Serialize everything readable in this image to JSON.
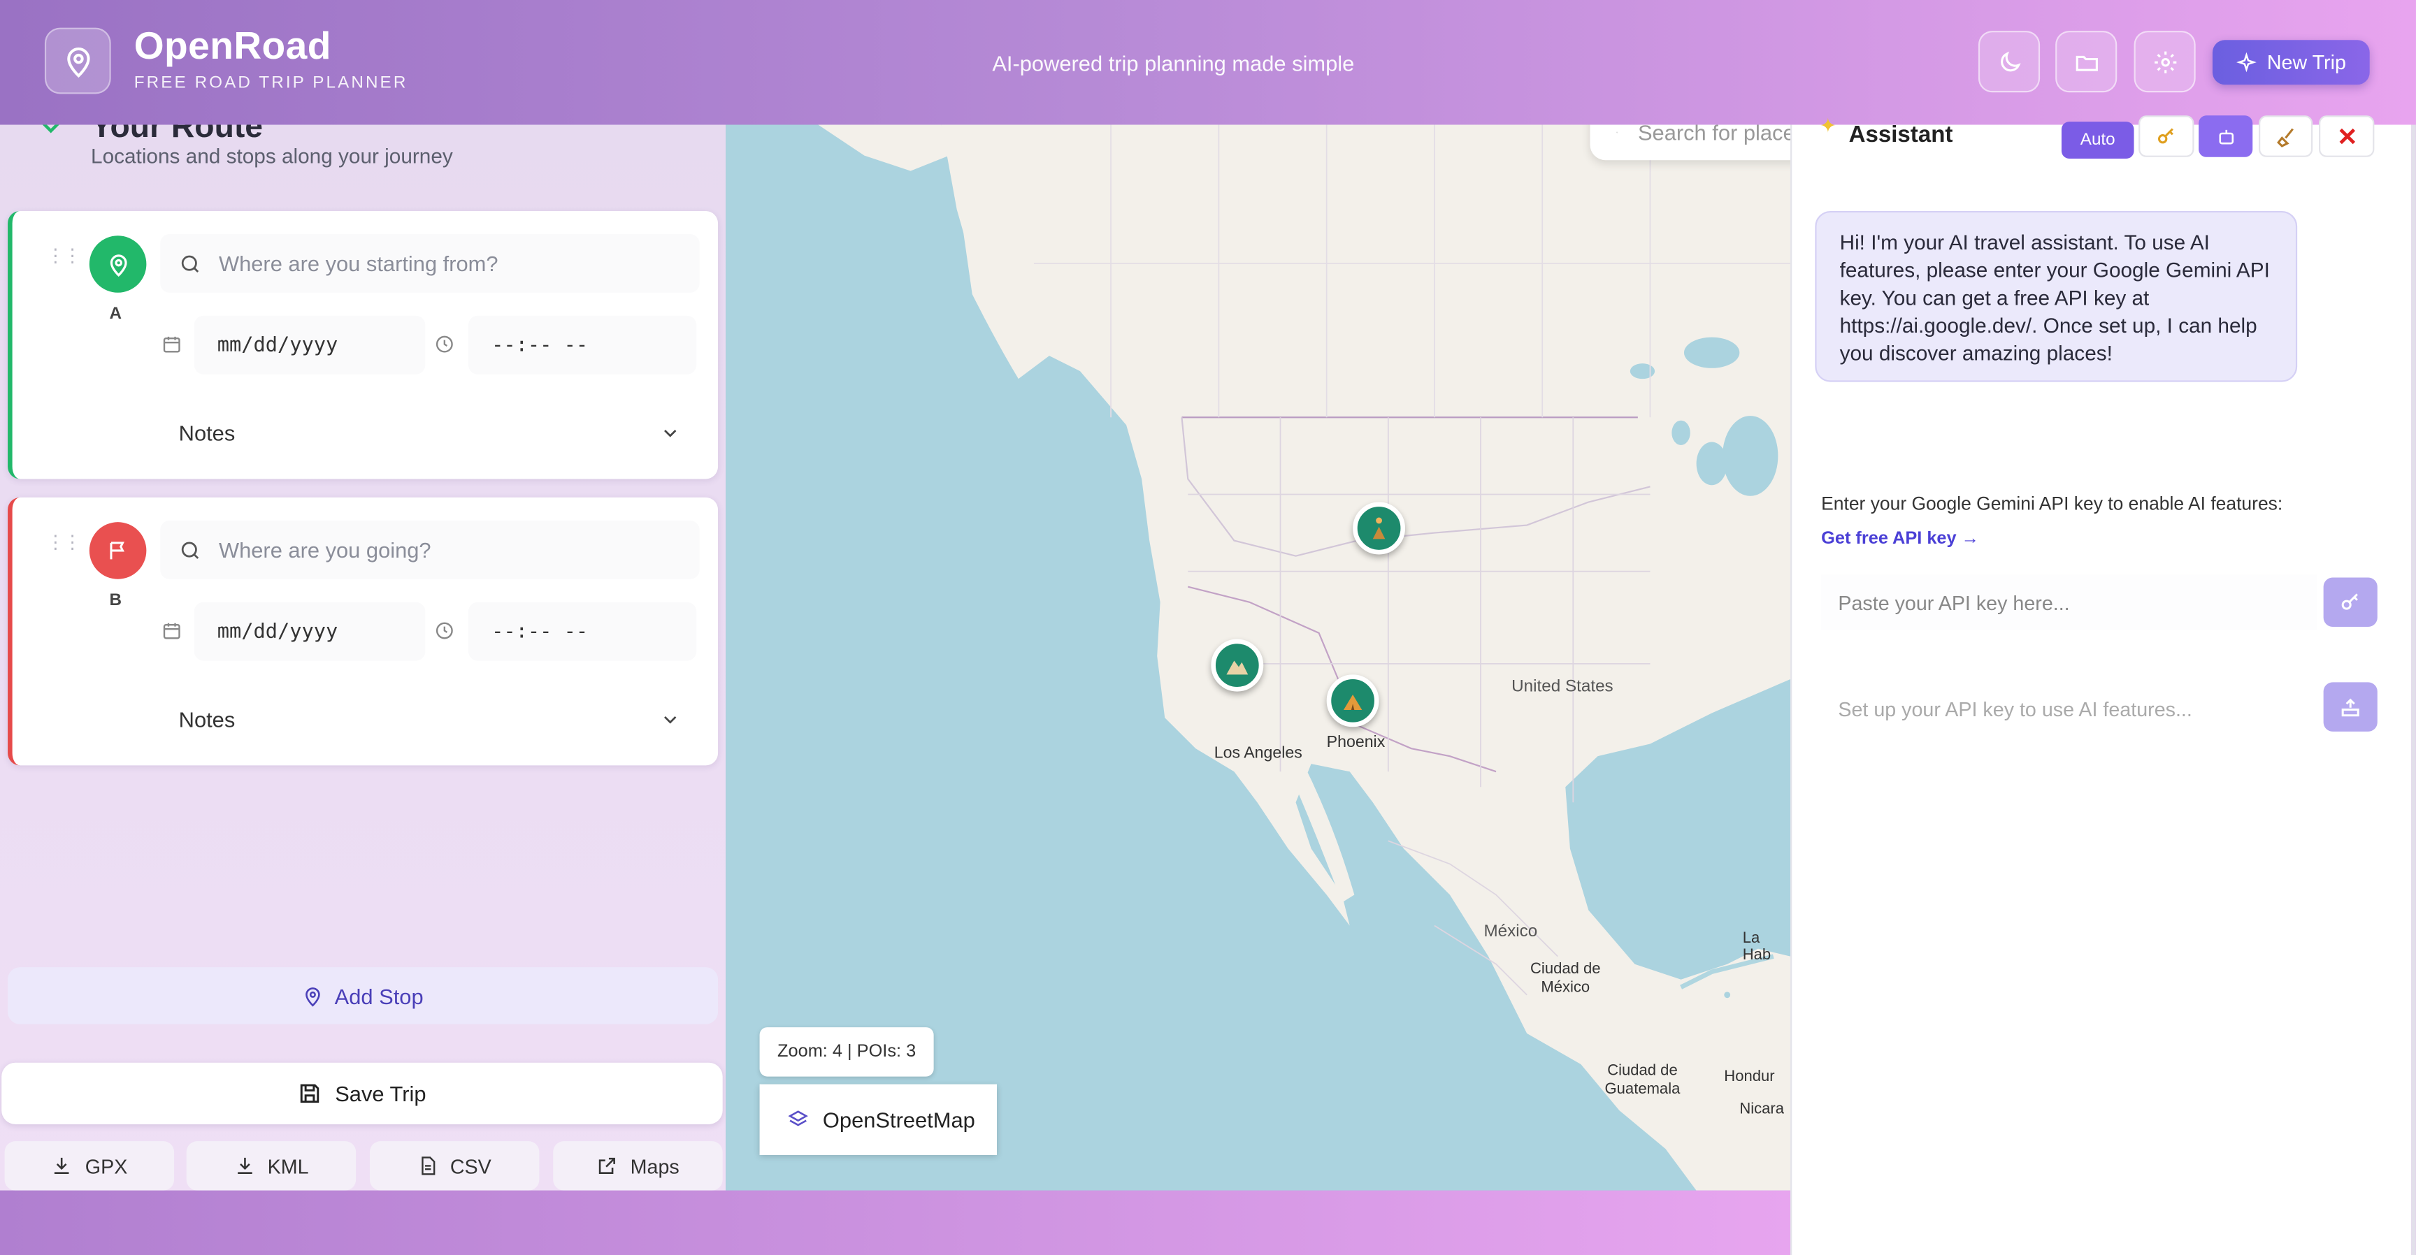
{
  "header": {
    "app_name": "OpenRoad",
    "tagline": "FREE ROAD TRIP PLANNER",
    "center_tagline": "AI-powered trip planning made simple",
    "new_trip_label": "New Trip"
  },
  "route": {
    "title": "Your Route",
    "subtitle": "Locations and stops along your journey",
    "stops": [
      {
        "letter": "A",
        "placeholder": "Where are you starting from?",
        "date": "mm/dd/yyyy",
        "time": "--:-- --",
        "notes_label": "Notes",
        "color": "#22b86a"
      },
      {
        "letter": "B",
        "placeholder": "Where are you going?",
        "date": "mm/dd/yyyy",
        "time": "--:-- --",
        "notes_label": "Notes",
        "color": "#e95050"
      }
    ],
    "add_stop_label": "Add Stop",
    "save_trip_label": "Save Trip",
    "exports": [
      "GPX",
      "KML",
      "CSV",
      "Maps"
    ]
  },
  "map": {
    "search_placeholder": "Search for places",
    "labels": {
      "united_states": "United States",
      "los_angeles": "Los Angeles",
      "phoenix": "Phoenix",
      "mexico": "México",
      "mexico_city": "Ciudad de México",
      "guatemala": "Ciudad de Guatemala",
      "honduras": "Hondur",
      "nicaragua": "Nicara",
      "havana": "La Hab"
    },
    "zoom_status": "Zoom: 4 | POIs: 3",
    "layer_label": "OpenStreetMap"
  },
  "assistant": {
    "title": "Assistant",
    "auto_label": "Auto",
    "greeting": "Hi! I'm your AI travel assistant. To use AI features, please enter your Google Gemini API key. You can get a free API key at https://ai.google.dev/. Once set up, I can help you discover amazing places!",
    "api_prompt": "Enter your Google Gemini API key to enable AI features:",
    "api_link": "Get free API key →",
    "api_placeholder": "Paste your API key here...",
    "chat_placeholder": "Set up your API key to use AI features..."
  },
  "colors": {
    "accent": "#6b5fe0",
    "start": "#22b86a",
    "end": "#e95050",
    "poi": "#1d8a6c"
  }
}
